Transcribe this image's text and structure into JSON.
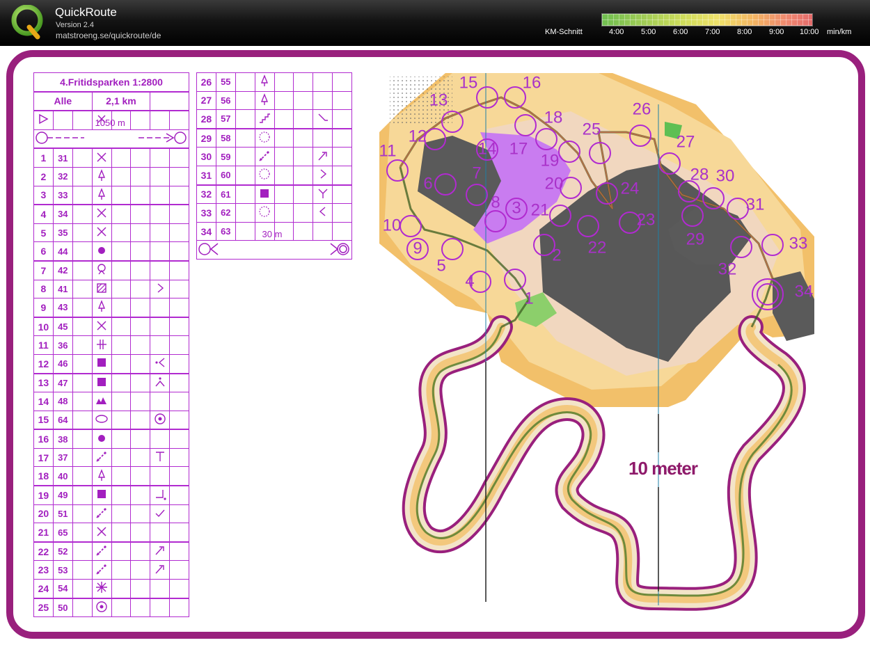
{
  "header": {
    "title": "QuickRoute",
    "version": "Version 2.4",
    "url": "matstroeng.se/quickroute/de",
    "speed_label": "KM-Schnitt",
    "ticks": [
      "4:00",
      "5:00",
      "6:00",
      "7:00",
      "8:00",
      "9:00",
      "10:00"
    ],
    "unit": "min/km"
  },
  "colors": {
    "frame": "#99207d",
    "control": "#b12ad0",
    "scale_text": "#8e1a6a"
  },
  "course": {
    "title": "4.Fritidsparken 1:2800",
    "class": "Alle",
    "length": "2,1 km",
    "marked_route": "1050 m",
    "finish_route": "30 m"
  },
  "controls_left": [
    {
      "n": "1",
      "code": "31",
      "sym": "cross-icon",
      "extra": ""
    },
    {
      "n": "2",
      "code": "32",
      "sym": "tree-icon",
      "extra": ""
    },
    {
      "n": "3",
      "code": "33",
      "sym": "tree-icon",
      "extra": ""
    },
    {
      "n": "4",
      "code": "34",
      "sym": "cross-icon",
      "extra": ""
    },
    {
      "n": "5",
      "code": "35",
      "sym": "cross-icon",
      "extra": ""
    },
    {
      "n": "6",
      "code": "44",
      "sym": "dot-icon",
      "extra": ""
    },
    {
      "n": "7",
      "code": "42",
      "sym": "bush-icon",
      "extra": ""
    },
    {
      "n": "8",
      "code": "41",
      "sym": "hatched-square-icon",
      "extra": "angle-right-icon"
    },
    {
      "n": "9",
      "code": "43",
      "sym": "tree-icon",
      "extra": ""
    },
    {
      "n": "10",
      "code": "45",
      "sym": "cross-icon",
      "extra": ""
    },
    {
      "n": "11",
      "code": "36",
      "sym": "fence-end-icon",
      "extra": ""
    },
    {
      "n": "12",
      "code": "46",
      "sym": "filled-square-icon",
      "extra": "side-left-icon"
    },
    {
      "n": "13",
      "code": "47",
      "sym": "filled-square-icon",
      "extra": "top-corner-icon"
    },
    {
      "n": "14",
      "code": "48",
      "sym": "rocky-icon",
      "extra": ""
    },
    {
      "n": "15",
      "code": "64",
      "sym": "ellipse-icon",
      "extra": "circle-dot-icon"
    },
    {
      "n": "16",
      "code": "38",
      "sym": "dot-icon",
      "extra": ""
    },
    {
      "n": "17",
      "code": "37",
      "sym": "wall-icon",
      "extra": "t-icon"
    },
    {
      "n": "18",
      "code": "40",
      "sym": "tree-icon",
      "extra": ""
    },
    {
      "n": "19",
      "code": "49",
      "sym": "filled-square-icon",
      "extra": "corner-inside-icon"
    },
    {
      "n": "20",
      "code": "51",
      "sym": "wall-icon",
      "extra": "corner-check-icon"
    },
    {
      "n": "21",
      "code": "65",
      "sym": "cross-icon",
      "extra": ""
    },
    {
      "n": "22",
      "code": "52",
      "sym": "wall-icon",
      "extra": "end-icon"
    },
    {
      "n": "23",
      "code": "53",
      "sym": "wall-icon",
      "extra": "end-icon"
    },
    {
      "n": "24",
      "code": "54",
      "sym": "special-icon",
      "extra": ""
    },
    {
      "n": "25",
      "code": "50",
      "sym": "circle-dot-icon",
      "extra": ""
    }
  ],
  "controls_right": [
    {
      "n": "26",
      "code": "55",
      "sym": "tree-icon",
      "extra": ""
    },
    {
      "n": "27",
      "code": "56",
      "sym": "tree-icon",
      "extra": ""
    },
    {
      "n": "28",
      "code": "57",
      "sym": "stairs-icon",
      "extra": "corner-down-icon"
    },
    {
      "n": "29",
      "code": "58",
      "sym": "dotted-circle-icon",
      "extra": ""
    },
    {
      "n": "30",
      "code": "59",
      "sym": "wall-icon",
      "extra": "end-icon"
    },
    {
      "n": "31",
      "code": "60",
      "sym": "dotted-circle-icon",
      "extra": "angle-right-icon"
    },
    {
      "n": "32",
      "code": "61",
      "sym": "filled-square-icon",
      "extra": "fork-icon"
    },
    {
      "n": "33",
      "code": "62",
      "sym": "dotted-circle-icon",
      "extra": "angle-left-icon"
    },
    {
      "n": "34",
      "code": "63",
      "sym": "",
      "extra": ""
    }
  ],
  "map_labels": [
    "1",
    "2",
    "3",
    "4",
    "5",
    "6",
    "7",
    "8",
    "9",
    "10",
    "11",
    "12",
    "13",
    "14",
    "15",
    "16",
    "17",
    "18",
    "19",
    "20",
    "21",
    "22",
    "23",
    "24",
    "25",
    "26",
    "27",
    "28",
    "29",
    "30",
    "31",
    "32",
    "33",
    "34"
  ],
  "scale_label": "10 meter"
}
